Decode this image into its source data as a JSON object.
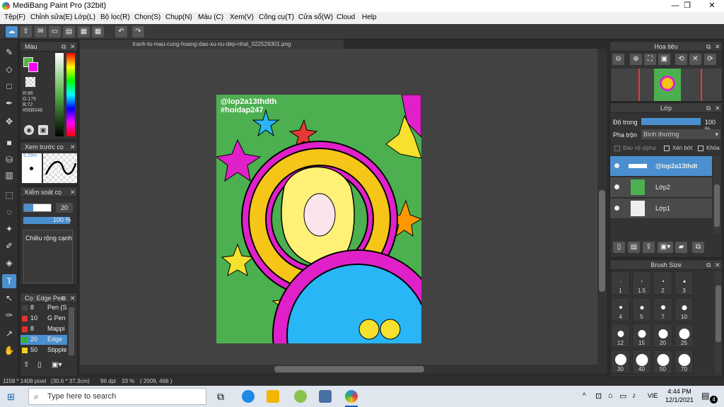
{
  "window": {
    "title": "MediBang Paint Pro (32bit)",
    "minimize": "—",
    "maximize": "❐",
    "close": "✕"
  },
  "menu": [
    "Tệp(F)",
    "Chỉnh sửa(E)",
    "Lớp(L)",
    "Bộ lọc(R)",
    "Chọn(S)",
    "Chụp(N)",
    "Màu (C)",
    "Xem(V)",
    "Công cụ(T)",
    "Cửa sổ(W)",
    "Cloud",
    "Help"
  ],
  "doc_tab": "tranh-to-mau-cung-hoang-dao-xu-nu-dep-nhat_022529301.png",
  "color_panel": {
    "title": "Màu",
    "r": "R:86",
    "g": "G:176",
    "b": "B:72",
    "hex": "#56B048",
    "fg": "#56b048",
    "bg": "#ff00ff"
  },
  "preview_panel": {
    "title": "Xem trước cọ",
    "size": "5.29m"
  },
  "brush_ctrl": {
    "title": "Kiểm soát cọ",
    "size_val": "20",
    "opacity_val": "100 %",
    "width_label": "Chiều rộng cạnh"
  },
  "pen_list": {
    "title": "Cọ: Edge Pen",
    "rows": [
      {
        "num": "8",
        "name": "Pen (S",
        "color": "#444444"
      },
      {
        "num": "10",
        "name": "G Pen",
        "color": "#e33030"
      },
      {
        "num": "8",
        "name": "Mappi",
        "color": "#e33030"
      },
      {
        "num": "20",
        "name": "Edge",
        "color": "#2db52d"
      },
      {
        "num": "50",
        "name": "Stipple",
        "color": "#f0d020"
      }
    ]
  },
  "navigator": {
    "title": "Hoa tiêu"
  },
  "layers_panel": {
    "title": "Lớp",
    "opacity_label": "Độ trong",
    "opacity_val": "100 %",
    "blend_label": "Pha trộn",
    "blend_val": "Bình thường",
    "protect_alpha": "Bảo vệ alpha",
    "clip": "Xén bớt",
    "lock": "Khóa",
    "layers": [
      {
        "name": "@lop2a13thdt",
        "selected": true
      },
      {
        "name": "Lớp2",
        "selected": false
      },
      {
        "name": "Lớp1",
        "selected": false
      }
    ]
  },
  "brush_size": {
    "title": "Brush Size",
    "sizes": [
      "1",
      "1.5",
      "2",
      "3",
      "4",
      "5",
      "7",
      "10",
      "12",
      "15",
      "20",
      "25",
      "30",
      "40",
      "50",
      "70"
    ]
  },
  "artwork": {
    "watermark1": "@lop2a13thdth",
    "watermark2": "#hoidap247"
  },
  "status": {
    "size": "1158 * 1408 pixel",
    "cm": "(30.6 * 37.3cm)",
    "dpi": "96 dpi",
    "zoom": "33 %",
    "coords": "( 2009, 466 )"
  },
  "taskbar": {
    "search_placeholder": "Type here to search",
    "time": "4:44 PM",
    "date": "12/1/2021",
    "lang": "VIE",
    "notif": "4"
  }
}
